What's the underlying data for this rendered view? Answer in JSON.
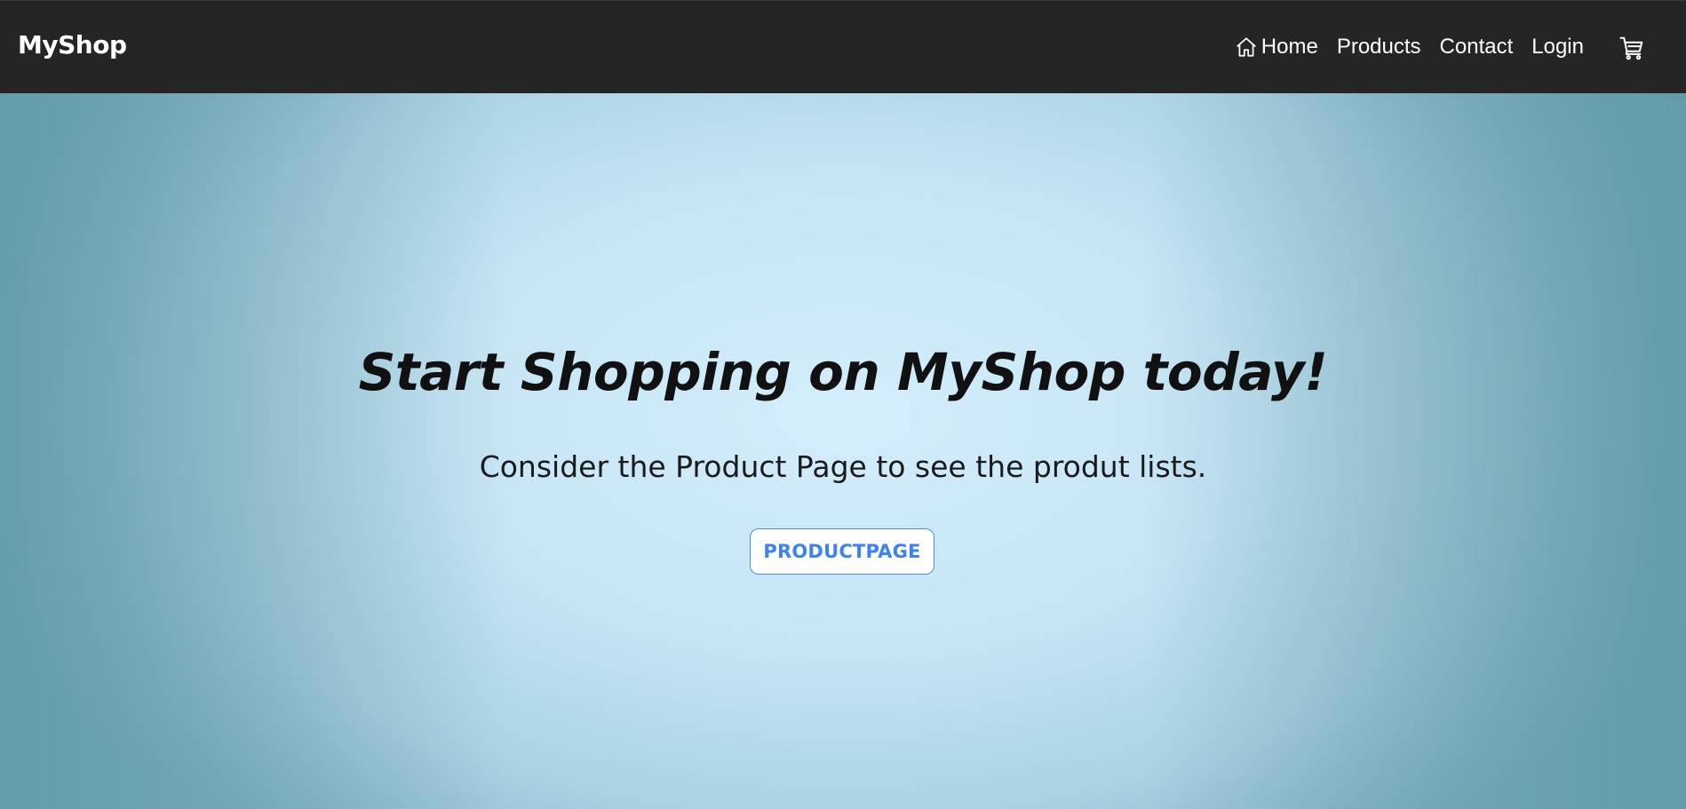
{
  "navbar": {
    "brand": "MyShop",
    "links": [
      {
        "label": "Home",
        "icon": "home-icon"
      },
      {
        "label": "Products"
      },
      {
        "label": "Contact"
      },
      {
        "label": "Login"
      }
    ],
    "cart_icon": "shopping-cart-icon",
    "background_color": "#252525"
  },
  "hero": {
    "title": "Start Shopping on MyShop today!",
    "subtitle": "Consider the Product Page to see the produt lists.",
    "button_label": "PRODUCTPAGE",
    "accent_color": "#3b82f6"
  }
}
